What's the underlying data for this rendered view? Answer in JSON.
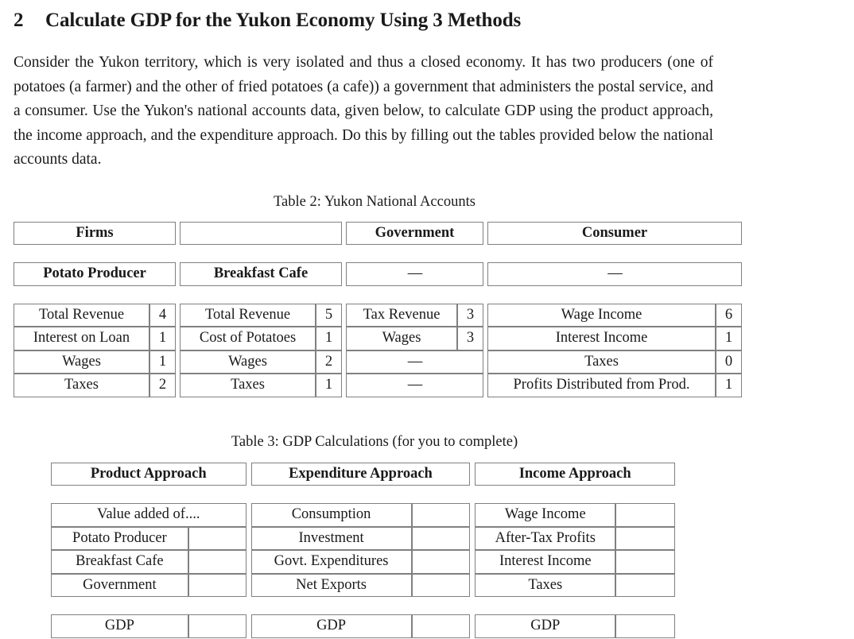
{
  "section": {
    "number": "2",
    "title": "Calculate GDP for the Yukon Economy Using 3 Methods"
  },
  "paragraph": "Consider the Yukon territory, which is very isolated and thus a closed economy.  It has two producers (one of potatoes (a farmer) and the other of fried potatoes (a cafe)) a government that administers the postal service, and a consumer.  Use the Yukon's national accounts data, given below, to calculate GDP using the product approach, the income approach, and the expenditure approach. Do this by filling out the tables provided below the national accounts data.",
  "table2": {
    "caption": "Table 2: Yukon National Accounts",
    "group_headers": {
      "firms": "Firms",
      "government": "Government",
      "consumer": "Consumer"
    },
    "sub_headers": {
      "potato_producer": "Potato Producer",
      "breakfast_cafe": "Breakfast Cafe",
      "government_dash": "—",
      "consumer_dash": "—"
    },
    "rows": [
      {
        "potato_label": "Total Revenue",
        "potato_value": "4",
        "cafe_label": "Total Revenue",
        "cafe_value": "5",
        "govt_label": "Tax Revenue",
        "govt_value": "3",
        "govt_span": false,
        "consumer_label": "Wage Income",
        "consumer_value": "6"
      },
      {
        "potato_label": "Interest on Loan",
        "potato_value": "1",
        "cafe_label": "Cost of Potatoes",
        "cafe_value": "1",
        "govt_label": "Wages",
        "govt_value": "3",
        "govt_span": false,
        "consumer_label": "Interest Income",
        "consumer_value": "1"
      },
      {
        "potato_label": "Wages",
        "potato_value": "1",
        "cafe_label": "Wages",
        "cafe_value": "2",
        "govt_label": "—",
        "govt_value": "",
        "govt_span": true,
        "consumer_label": "Taxes",
        "consumer_value": "0"
      },
      {
        "potato_label": "Taxes",
        "potato_value": "2",
        "cafe_label": "Taxes",
        "cafe_value": "1",
        "govt_label": "—",
        "govt_value": "",
        "govt_span": true,
        "consumer_label": "Profits Distributed from Prod.",
        "consumer_value": "1"
      }
    ]
  },
  "table3": {
    "caption": "Table 3: GDP Calculations (for you to complete)",
    "headers": {
      "product": "Product Approach",
      "expenditure": "Expenditure Approach",
      "income": "Income Approach"
    },
    "product_rows": [
      {
        "label": "Value added of....",
        "value": "",
        "span": true
      },
      {
        "label": "Potato Producer",
        "value": "",
        "span": false
      },
      {
        "label": "Breakfast Cafe",
        "value": "",
        "span": false
      },
      {
        "label": "Government",
        "value": "",
        "span": false
      }
    ],
    "expenditure_rows": [
      {
        "label": "Consumption",
        "value": ""
      },
      {
        "label": "Investment",
        "value": ""
      },
      {
        "label": "Govt. Expenditures",
        "value": ""
      },
      {
        "label": "Net Exports",
        "value": ""
      }
    ],
    "income_rows": [
      {
        "label": "Wage Income",
        "value": ""
      },
      {
        "label": "After-Tax Profits",
        "value": ""
      },
      {
        "label": "Interest Income",
        "value": ""
      },
      {
        "label": "Taxes",
        "value": ""
      }
    ],
    "total_rows": {
      "product_label": "GDP",
      "product_value": "",
      "expenditure_label": "GDP",
      "expenditure_value": "",
      "income_label": "GDP",
      "income_value": ""
    }
  }
}
